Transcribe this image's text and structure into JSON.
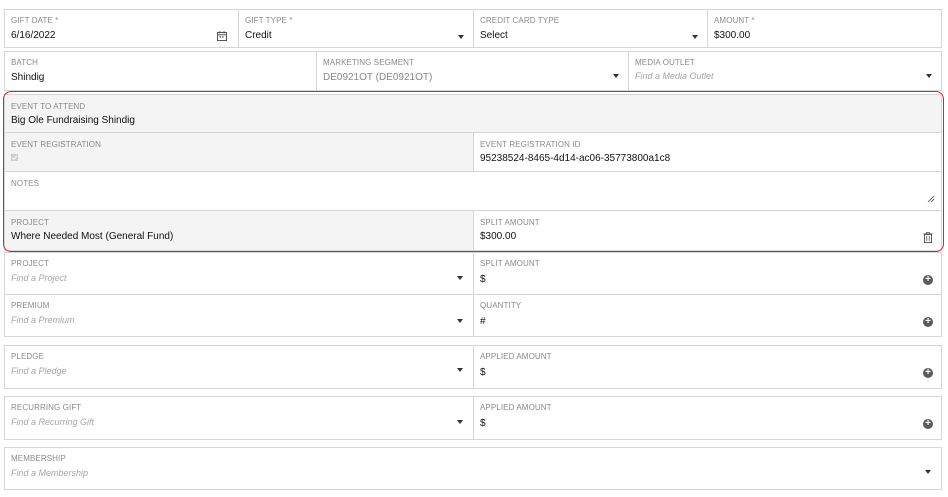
{
  "row1": {
    "gift_date": {
      "label": "GIFT DATE *",
      "value": "6/16/2022"
    },
    "gift_type": {
      "label": "GIFT TYPE *",
      "value": "Credit"
    },
    "credit_card_type": {
      "label": "CREDIT CARD TYPE",
      "value": "Select"
    },
    "amount": {
      "label": "AMOUNT *",
      "value": "$300.00"
    }
  },
  "row2": {
    "batch": {
      "label": "BATCH",
      "value": "Shindig"
    },
    "marketing_segment": {
      "label": "MARKETING SEGMENT",
      "value": "DE0921OT (DE0921OT)"
    },
    "media_outlet": {
      "label": "MEDIA OUTLET",
      "placeholder": "Find a Media Outlet"
    }
  },
  "highlighted": {
    "event_to_attend": {
      "label": "EVENT TO ATTEND",
      "value": "Big Ole Fundraising Shindig"
    },
    "event_registration": {
      "label": "EVENT REGISTRATION",
      "checked": true
    },
    "event_registration_id": {
      "label": "EVENT REGISTRATION ID",
      "value": "95238524-8465-4d14-ac06-35773800a1c8"
    },
    "notes": {
      "label": "NOTES",
      "value": ""
    },
    "project": {
      "label": "PROJECT",
      "value": "Where Needed Most (General Fund)"
    },
    "split_amount": {
      "label": "SPLIT AMOUNT",
      "value": "$300.00"
    },
    "border_color": "#e0212a"
  },
  "project_row": {
    "project": {
      "label": "PROJECT",
      "placeholder": "Find a Project"
    },
    "split_amount": {
      "label": "SPLIT AMOUNT",
      "value": "$"
    }
  },
  "premium_row": {
    "premium": {
      "label": "PREMIUM",
      "placeholder": "Find a Premium"
    },
    "quantity": {
      "label": "QUANTITY",
      "value": "#"
    }
  },
  "pledge_row": {
    "pledge": {
      "label": "PLEDGE",
      "placeholder": "Find a Pledge"
    },
    "applied_amount": {
      "label": "APPLIED AMOUNT",
      "value": "$"
    }
  },
  "recurring_row": {
    "recurring_gift": {
      "label": "RECURRING GIFT",
      "placeholder": "Find a Recurring Gift"
    },
    "applied_amount": {
      "label": "APPLIED AMOUNT",
      "value": "$"
    }
  },
  "membership_row": {
    "membership": {
      "label": "MEMBERSHIP",
      "placeholder": "Find a Membership"
    }
  },
  "icons": {
    "calendar": "calendar-icon",
    "caret": "chevron-down-icon",
    "plus": "plus-circle-icon",
    "trash": "trash-icon",
    "resize": "resize-handle-icon"
  }
}
